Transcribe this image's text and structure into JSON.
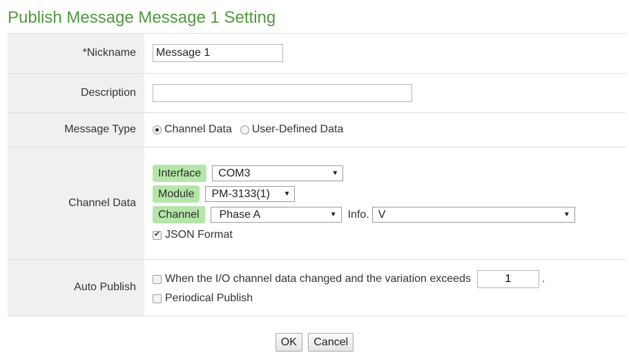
{
  "title": "Publish Message Message 1 Setting",
  "nickname": {
    "label": "*Nickname",
    "value": "Message 1"
  },
  "description": {
    "label": "Description",
    "value": ""
  },
  "message_type": {
    "label": "Message Type",
    "options": [
      "Channel Data",
      "User-Defined Data"
    ],
    "selected": "Channel Data"
  },
  "channel_data": {
    "label": "Channel Data",
    "interface_label": "Interface",
    "interface_value": "COM3",
    "module_label": "Module",
    "module_value": "PM-3133(1)",
    "channel_label": "Channel",
    "channel_value": "Phase A",
    "info_label": "Info.",
    "info_value": "V",
    "json_format_label": "JSON Format",
    "json_format_checked": true
  },
  "auto_publish": {
    "label": "Auto Publish",
    "variation_text": "When the I/O channel data changed and the variation exceeds",
    "variation_value": "1",
    "variation_suffix": ".",
    "variation_checked": false,
    "periodical_text": "Periodical Publish",
    "periodical_checked": false
  },
  "buttons": {
    "ok": "OK",
    "cancel": "Cancel"
  }
}
